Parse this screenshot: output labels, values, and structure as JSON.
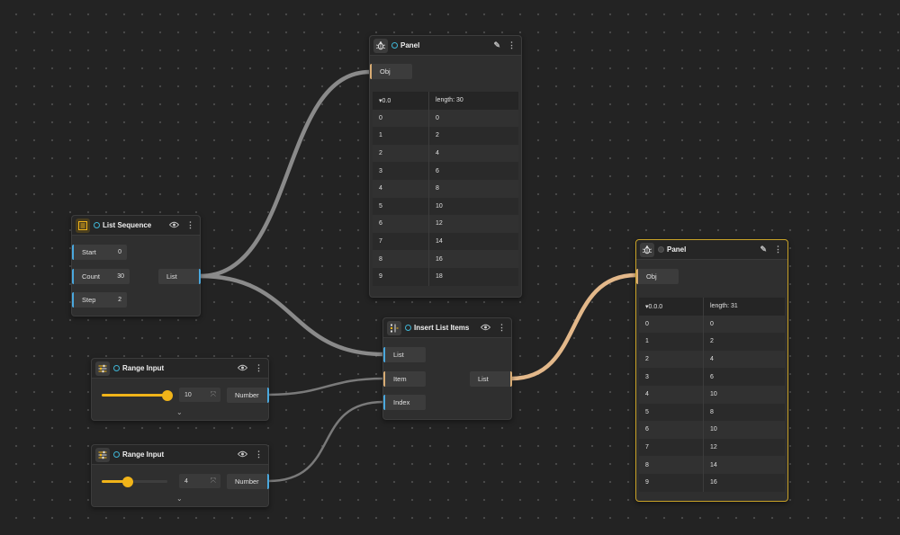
{
  "colors": {
    "wire_gray": "#8a8a8a",
    "wire_orange": "#e3b88a",
    "port_blue": "#4aa8de",
    "port_orange": "#d8ac74",
    "slider_yellow": "#f1b419",
    "selected_border": "#c9a227"
  },
  "list_sequence": {
    "title": "List Sequence",
    "icon": "list-sequence-icon",
    "inputs": [
      {
        "label": "Start",
        "value": "0"
      },
      {
        "label": "Count",
        "value": "30"
      },
      {
        "label": "Step",
        "value": "2"
      }
    ],
    "output": "List"
  },
  "range_input_1": {
    "title": "Range Input",
    "icon": "sliders-icon",
    "value": "10",
    "slider_fraction": 1.0,
    "output": "Number"
  },
  "range_input_2": {
    "title": "Range Input",
    "icon": "sliders-icon",
    "value": "4",
    "slider_fraction": 0.4,
    "output": "Number"
  },
  "insert_list_items": {
    "title": "Insert List Items",
    "icon": "insert-list-icon",
    "inputs": [
      "List",
      "Item",
      "Index"
    ],
    "output": "List"
  },
  "panel_1": {
    "title": "Panel",
    "icon": "bug-icon",
    "input": "Obj",
    "header_path": "▾0.0",
    "header_length": "length: 30",
    "rows": [
      [
        "0",
        "0"
      ],
      [
        "1",
        "2"
      ],
      [
        "2",
        "4"
      ],
      [
        "3",
        "6"
      ],
      [
        "4",
        "8"
      ],
      [
        "5",
        "10"
      ],
      [
        "6",
        "12"
      ],
      [
        "7",
        "14"
      ],
      [
        "8",
        "16"
      ],
      [
        "9",
        "18"
      ]
    ]
  },
  "panel_2": {
    "title": "Panel",
    "icon": "bug-icon",
    "input": "Obj",
    "header_path": "▾0.0.0",
    "header_length": "length: 31",
    "rows": [
      [
        "0",
        "0"
      ],
      [
        "1",
        "2"
      ],
      [
        "2",
        "4"
      ],
      [
        "3",
        "6"
      ],
      [
        "4",
        "10"
      ],
      [
        "5",
        "8"
      ],
      [
        "6",
        "10"
      ],
      [
        "7",
        "12"
      ],
      [
        "8",
        "14"
      ],
      [
        "9",
        "16"
      ]
    ]
  }
}
